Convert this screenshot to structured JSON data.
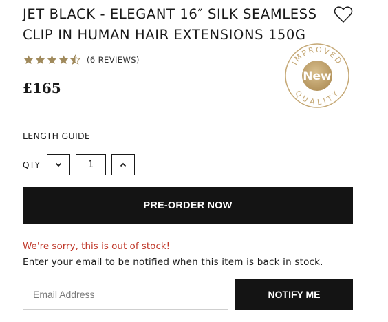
{
  "product": {
    "title": "JET BLACK - ELEGANT 16″ SILK SEAMLESS CLIP IN HUMAN HAIR EXTENSIONS 150G",
    "price": "£165",
    "rating": {
      "stars": 4.5,
      "reviews_label": "(6 REVIEWS)",
      "star_color": "#a08a5c"
    },
    "wishlist_icon": "heart-outline-icon"
  },
  "badge": {
    "top_text": "IMPROVED",
    "bottom_text": "QUALITY",
    "center_text": "New",
    "color": "#c5a875"
  },
  "length_guide": "LENGTH GUIDE",
  "quantity": {
    "label": "QTY",
    "value": "1",
    "decrement_icon": "chevron-down-icon",
    "increment_icon": "chevron-up-icon"
  },
  "preorder_label": "PRE-ORDER NOW",
  "stock": {
    "message": "We're sorry, this is out of stock!",
    "message_color": "#c0392b",
    "notify_text": "Enter your email to be notified when this item is back in stock."
  },
  "notify_form": {
    "placeholder": "Email Address",
    "button_label": "NOTIFY ME"
  }
}
